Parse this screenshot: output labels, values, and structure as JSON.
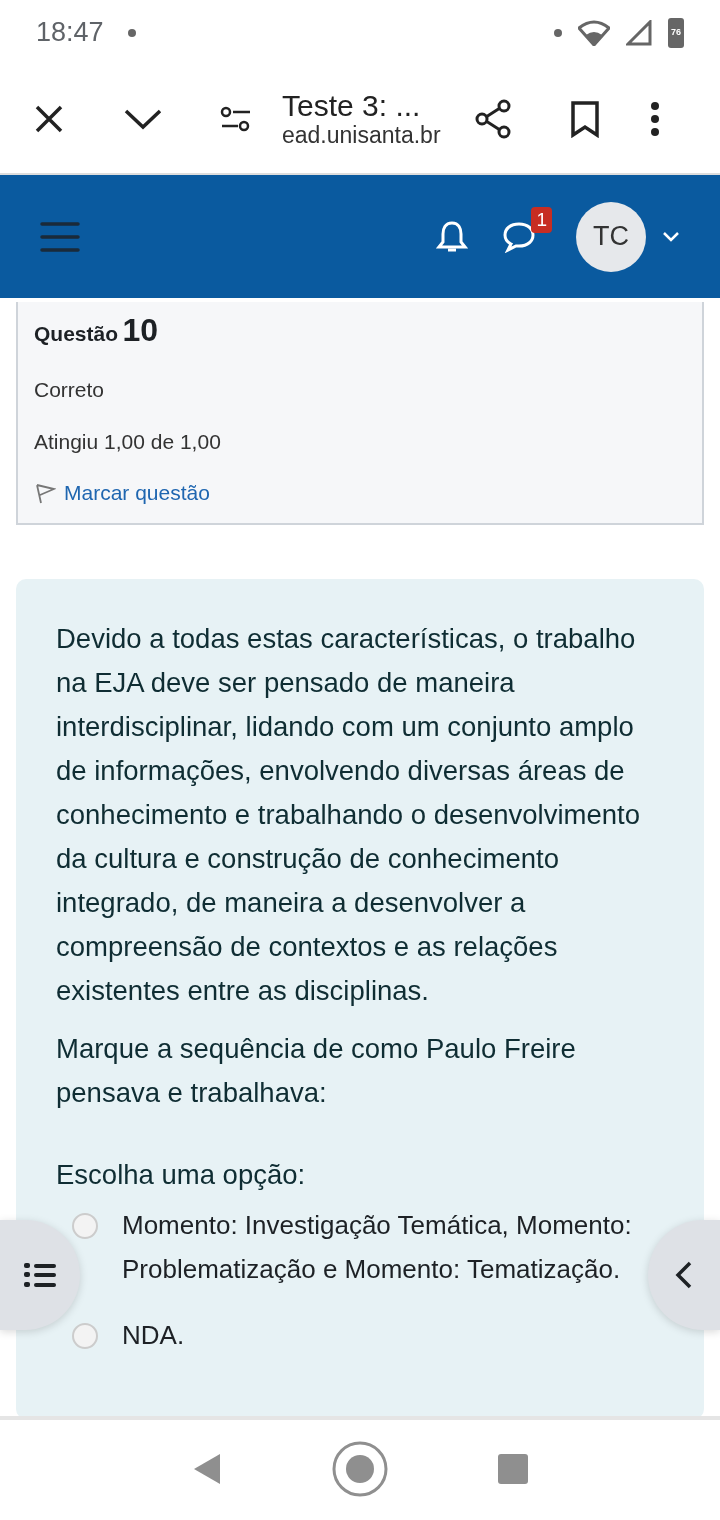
{
  "status_bar": {
    "time": "18:47",
    "battery": "76"
  },
  "browser": {
    "title": "Teste 3: ...",
    "url": "ead.unisanta.br"
  },
  "navbar": {
    "message_count": "1",
    "avatar_initials": "TC"
  },
  "question_info": {
    "label": "Questão",
    "number": "10",
    "state": "Correto",
    "grade": "Atingiu 1,00 de 1,00",
    "flag_label": "Marcar questão"
  },
  "question": {
    "paragraphs": [
      "Devido a todas estas características, o trabalho na EJA deve ser pensado de maneira interdisciplinar, lidando com um conjunto amplo de informações, envolvendo diversas áreas de conhecimento e trabalhando o desenvolvimento da cultura e construção de conhecimento integrado, de maneira a desenvolver a compreensão de contextos e as relações existentes entre as disciplinas.",
      "Marque a sequência de como Paulo Freire pensava e trabalhava:"
    ],
    "prompt": "Escolha uma opção:",
    "options": [
      {
        "text": "Momento: Investigação Temática, Momento: Problematização e Momento: Tematização.",
        "selected": false
      },
      {
        "text": "NDA.",
        "selected": false
      }
    ]
  }
}
